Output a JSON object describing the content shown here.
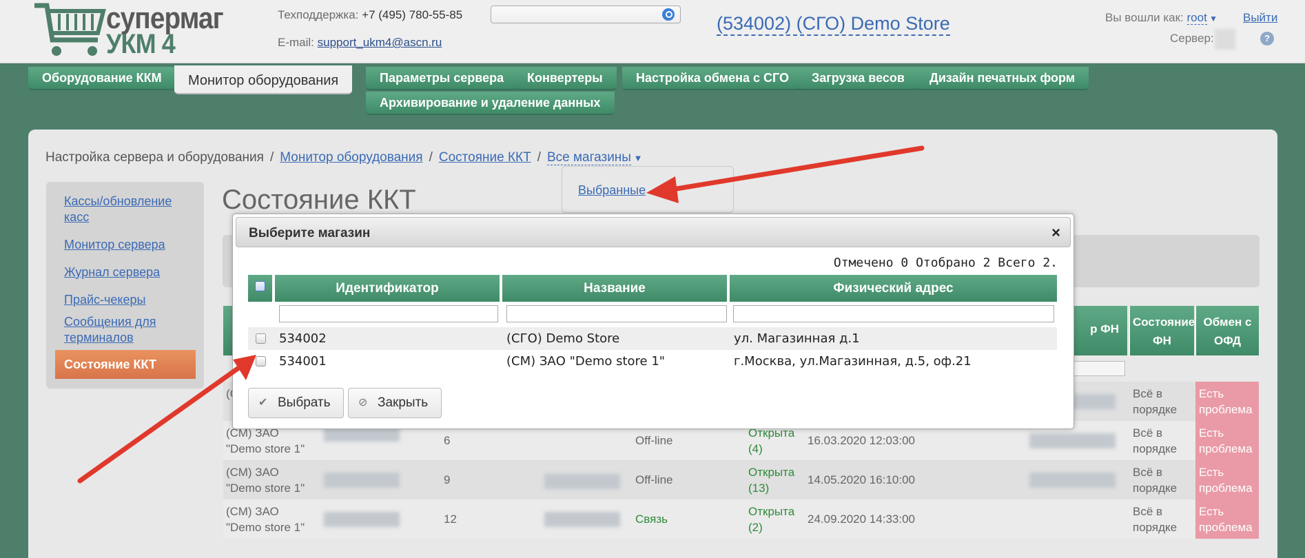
{
  "header": {
    "logo_line1": "супермаг",
    "logo_line2": "УКМ 4",
    "support_label": "Техподдержка:",
    "support_phone": "+7 (495) 780-55-85",
    "email_label": "E-mail:",
    "email": "support_ukm4@ascn.ru",
    "search_placeholder": "",
    "store_title": "(534002) (СГО) Demo Store",
    "logged_as_label": "Вы вошли как:",
    "user": "root",
    "logout": "Выйти",
    "server_label": "Сервер:",
    "help": "?"
  },
  "tabs": [
    {
      "label": "Оборудование ККМ"
    },
    {
      "label": "Монитор оборудования"
    },
    {
      "label": "Параметры сервера"
    },
    {
      "label": "Конвертеры"
    },
    {
      "label": "Настройка обмена с СГО"
    },
    {
      "label": "Загрузка весов"
    },
    {
      "label": "Дизайн печатных форм"
    },
    {
      "label": "Архивирование и удаление данных"
    }
  ],
  "breadcrumb": {
    "root": "Настройка сервера и оборудования",
    "sep": "/",
    "item1": "Монитор оборудования",
    "item2": "Состояние ККТ",
    "item3": "Все магазины"
  },
  "dropdown": {
    "item": "Выбранные"
  },
  "sidebar": {
    "items": [
      {
        "label": "Кассы/обновление касс"
      },
      {
        "label": "Монитор сервера"
      },
      {
        "label": "Журнал сервера"
      },
      {
        "label": "Прайс-чекеры"
      },
      {
        "label": "Сообщения для терминалов"
      }
    ],
    "active": "Состояние ККТ"
  },
  "page_title": "Состояние ККТ",
  "bg_table": {
    "headers": {
      "fn_partial": "р ФН",
      "fn_state": "Состояние ФН",
      "ofd": "Обмен с ОФД"
    },
    "rows": [
      {
        "store": "(С",
        "num": "",
        "status": "",
        "shift": "",
        "date": "",
        "fn": "Всё в порядке",
        "ofd": "Есть проблема"
      },
      {
        "store": "(СМ) ЗАО \"Demo store 1\"",
        "num": "6",
        "status": "Off-line",
        "shift": "Открыта (4)",
        "date": "16.03.2020 12:03:00",
        "fn": "Всё в порядке",
        "ofd": "Есть проблема"
      },
      {
        "store": "(СМ) ЗАО \"Demo store 1\"",
        "num": "9",
        "status": "Off-line",
        "shift": "Открыта (13)",
        "date": "14.05.2020 16:10:00",
        "fn": "Всё в порядке",
        "ofd": "Есть проблема"
      },
      {
        "store": "(СМ) ЗАО \"Demo store 1\"",
        "num": "12",
        "status": "Связь",
        "shift": "Открыта (2)",
        "date": "24.09.2020 14:33:00",
        "fn": "Всё в порядке",
        "ofd": "Есть проблема"
      }
    ]
  },
  "modal": {
    "title": "Выберите магазин",
    "close": "×",
    "counts": "Отмечено 0 Отобрано 2 Всего 2.",
    "columns": [
      "Идентификатор",
      "Название",
      "Физический адрес"
    ],
    "rows": [
      {
        "id": "534002",
        "name": "(СГО) Demo Store",
        "address": "ул. Магазинная д.1"
      },
      {
        "id": "534001",
        "name": "(СМ) ЗАО \"Demo store 1\"",
        "address": "г.Москва, ул.Магазинная, д.5, оф.21"
      }
    ],
    "select_button": "Выбрать",
    "close_button": "Закрыть"
  },
  "colors": {
    "accent_green": "#4e7f6a",
    "link": "#3a6ab5",
    "arrow": "#e0392c",
    "active_orange": "#e08552"
  }
}
